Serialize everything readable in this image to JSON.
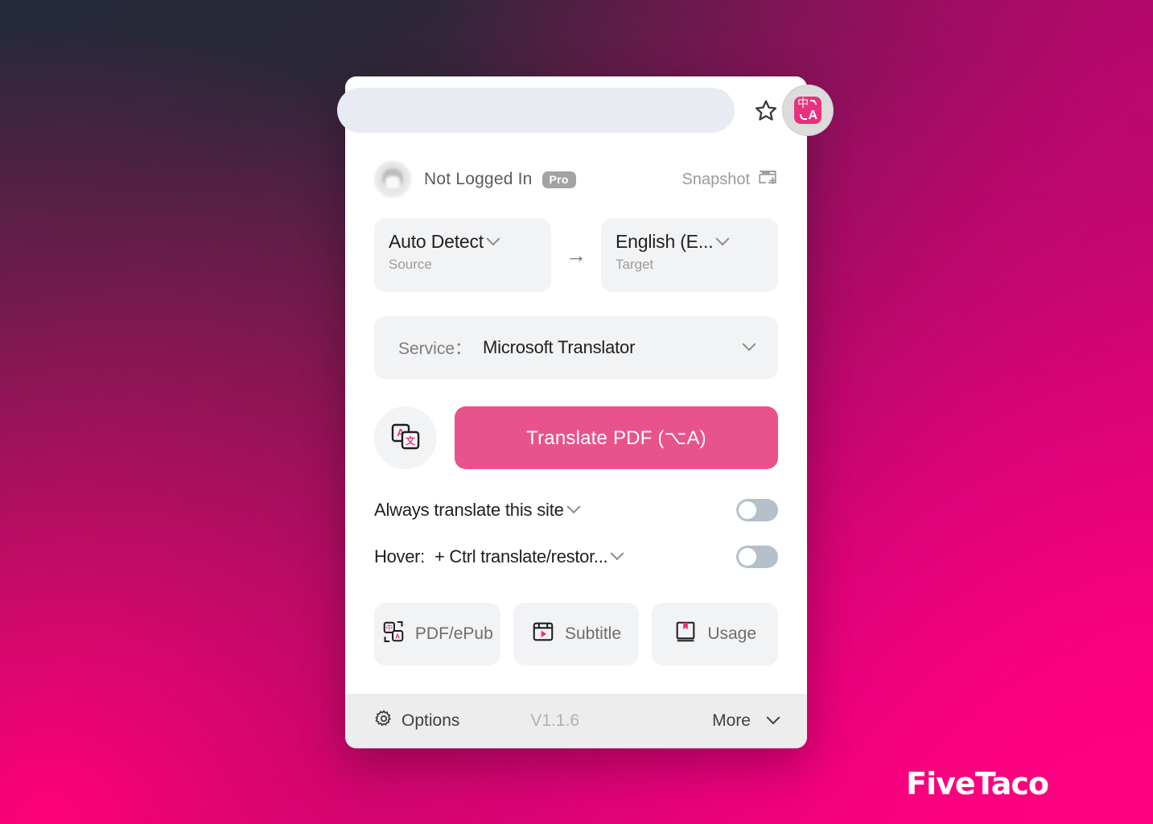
{
  "browser": {
    "star_icon": "bookmark-star-icon",
    "extension_icon": "translate-extension-icon",
    "extension_icon_glyphs": {
      "cjk": "中",
      "latin": "A"
    }
  },
  "account": {
    "name": "Not Logged In",
    "badge": "Pro",
    "avatar_icon": "user-avatar",
    "snapshot_label": "Snapshot",
    "snapshot_icon": "window-plus-icon"
  },
  "languages": {
    "source": {
      "value": "Auto Detect",
      "sub": "Source"
    },
    "arrow": "→",
    "target": {
      "value": "English (E...",
      "sub": "Target"
    }
  },
  "service": {
    "label": "Service：",
    "value": "Microsoft Translator"
  },
  "action": {
    "secondary_icon": "translate-document-icon",
    "translate_label": "Translate PDF (⌥A)"
  },
  "toggles": [
    {
      "label": "Always translate this site",
      "state": "off"
    },
    {
      "label_prefix": "Hover:",
      "label": "+ Ctrl translate/restor...",
      "state": "off"
    }
  ],
  "quick_buttons": [
    {
      "label": "PDF/ePub",
      "icon": "pdf-epub-icon"
    },
    {
      "label": "Subtitle",
      "icon": "subtitle-icon"
    },
    {
      "label": "Usage",
      "icon": "usage-book-icon"
    }
  ],
  "footer": {
    "options_label": "Options",
    "options_icon": "gear-icon",
    "version": "V1.1.6",
    "more_label": "More",
    "more_icon": "chevron-down-icon"
  },
  "watermark": {
    "text": "FiveTaco"
  },
  "colors": {
    "accent_pink": "#E8538C",
    "brand_pink": "#E8317E",
    "bg_dark": "#252A3A",
    "bg_magenta": "#B8086C",
    "bg_hot_pink": "#FC0077",
    "panel_gray": "#F2F3F5",
    "toggle_off": "#B6C0CB"
  }
}
